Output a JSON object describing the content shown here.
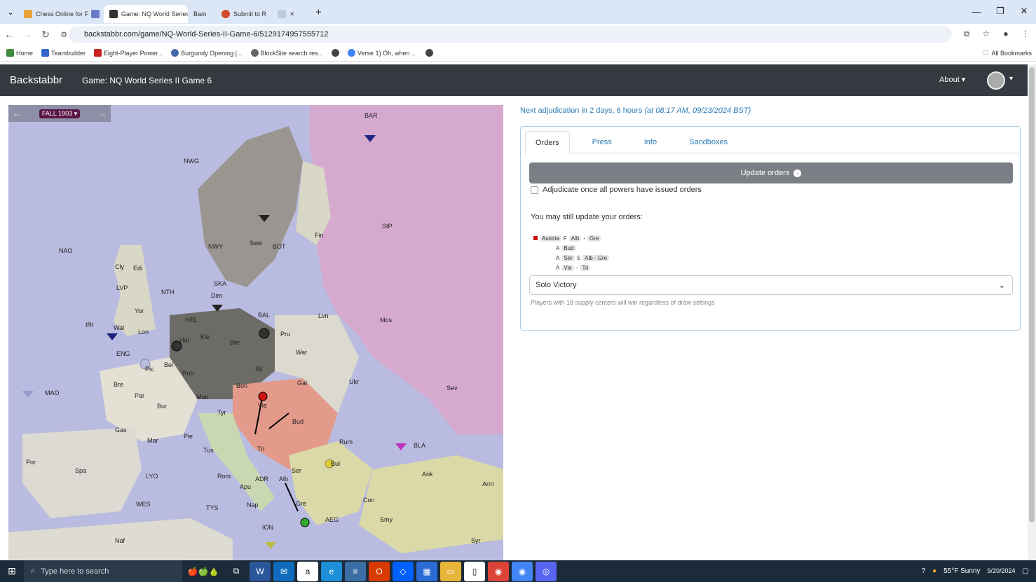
{
  "browser": {
    "tabs": [
      {
        "label": "Chess Online for FREE",
        "color": "#e8a23a"
      },
      {
        "label": "Game: NQ World Series I",
        "color": "#333333",
        "active": true
      },
      {
        "label": "Bam",
        "color": "#2b79c2"
      },
      {
        "label": "Submit to R",
        "color": "#d24b2c"
      }
    ],
    "address": "backstabbr.com/game/NQ-World-Series-II-Game-6/5129174957555712",
    "bookmarks": [
      {
        "label": "Home",
        "color": "#3c8c3c"
      },
      {
        "label": "Teambuilder",
        "color": "#3366cc"
      },
      {
        "label": "Eight-Player Power...",
        "color": "#cc2222"
      },
      {
        "label": "Burgundy Opening |...",
        "color": "#4466aa"
      },
      {
        "label": "BlockSite search res...",
        "color": "#666666"
      },
      {
        "label": "",
        "color": "#444444"
      },
      {
        "label": "Verse 1) Oh, when ...",
        "color": "#4285f4"
      },
      {
        "label": "",
        "color": "#444444"
      }
    ],
    "all_bookmarks": "All Bookmarks"
  },
  "site": {
    "brand": "Backstabbr",
    "game_title": "Game: NQ World Series II Game 6",
    "about": "About",
    "accent": "#343a40"
  },
  "map": {
    "phase": "FALL 1903",
    "provinces": [
      "BAR",
      "NWG",
      "NAO",
      "Cly",
      "Edi",
      "LVP",
      "NTH",
      "Yor",
      "IRI",
      "Wal",
      "Lon",
      "ENG",
      "Bre",
      "Pic",
      "Par",
      "MAO",
      "Bur",
      "Gas",
      "Mar",
      "Spa",
      "Por",
      "LYO",
      "WES",
      "NAF",
      "Tus",
      "Rom",
      "Pie",
      "TYS",
      "Nap",
      "ION",
      "Apu",
      "ADR",
      "Tri",
      "Vie",
      "Bud",
      "Ser",
      "Alb",
      "Gre",
      "Bul",
      "AEG",
      "Con",
      "Smy",
      "Ank",
      "Arm",
      "Syr",
      "BLA",
      "Rum",
      "Sev",
      "Ukr",
      "Gal",
      "War",
      "Mos",
      "Lvn",
      "StP",
      "Fin",
      "Swe",
      "Nwy",
      "BOT",
      "SKA",
      "Den",
      "HEL",
      "Kie",
      "Ber",
      "Pru",
      "Sil",
      "Mun",
      "Boh",
      "Tyr",
      "Bel",
      "Hol"
    ]
  },
  "adjudication": {
    "text": "Next adjudication in 2 days, 6 hours",
    "when": "(at 08:17 AM, 09/23/2024 BST)"
  },
  "panel": {
    "tabs": [
      "Orders",
      "Press",
      "Info",
      "Sandboxes"
    ],
    "update_btn": "Update orders",
    "adjudicate_label": "Adjudicate once all powers have issued orders",
    "may_update": "You may still update your orders:",
    "power": "Austria",
    "orders": [
      {
        "unit": "F",
        "from": "Alb",
        "sep": "-",
        "to": "Gre"
      },
      {
        "unit": "A",
        "from": "Bud",
        "sep": "",
        "to": ""
      },
      {
        "unit": "A",
        "from": "Ser",
        "sep": "S",
        "to": "Alb - Gre"
      },
      {
        "unit": "A",
        "from": "Vie",
        "sep": "-",
        "to": "Tri"
      }
    ],
    "draw_type": "Solo Victory",
    "help": "Players with 18 supply centers will win regardless of draw settings"
  },
  "taskbar": {
    "search_placeholder": "Type here to search",
    "weather": "55°F  Sunny",
    "time": "",
    "date": "9/20/2024"
  }
}
